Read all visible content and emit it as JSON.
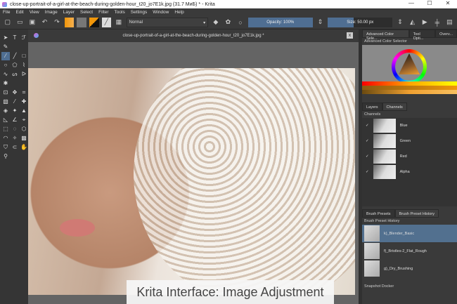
{
  "window": {
    "title": "close-up-portrait-of-a-girl-at-the-beach-during-golden-hour_t20_jo7E1k.jpg (31.7 MиБ) * - Krita",
    "min": "—",
    "max": "☐",
    "close": "✕"
  },
  "menu": [
    "File",
    "Edit",
    "View",
    "Image",
    "Layer",
    "Select",
    "Filter",
    "Tools",
    "Settings",
    "Window",
    "Help"
  ],
  "toolbar": {
    "blend_mode": "Normal",
    "opacity": "Opacity: 100%",
    "opacity_value": 100,
    "size": "Size: 50.00 px",
    "size_fill": 0.4,
    "fg_color": "#f0960a"
  },
  "document": {
    "tab_title": "close-up-portrait-of-a-girl-at-the-beach-during-golden-hour_t20_jo7E1k.jpg *",
    "close": "x"
  },
  "caption": "Krita Interface: Image Adjustment",
  "dock": {
    "top_tabs": [
      "Advanced Color Sele...",
      "Tool Opti...",
      "Overv..."
    ],
    "color_selector_title": "Advanced Color Selector",
    "mid_tabs": [
      "Layers",
      "Channels"
    ],
    "channels_title": "Channels",
    "channels": [
      {
        "name": "Blue",
        "check": "✓"
      },
      {
        "name": "Green",
        "check": "✓"
      },
      {
        "name": "Red",
        "check": "✓"
      },
      {
        "name": "Alpha",
        "check": "✓"
      }
    ],
    "preset_tabs": [
      "Brush Presets",
      "Brush Preset History"
    ],
    "preset_history_title": "Brush Preset History",
    "presets": [
      "k)_Blender_Basic",
      "f)_Bristles-2_Flat_Rough",
      "g)_Dry_Brushing"
    ],
    "snapshot_title": "Snapshot Docker"
  }
}
